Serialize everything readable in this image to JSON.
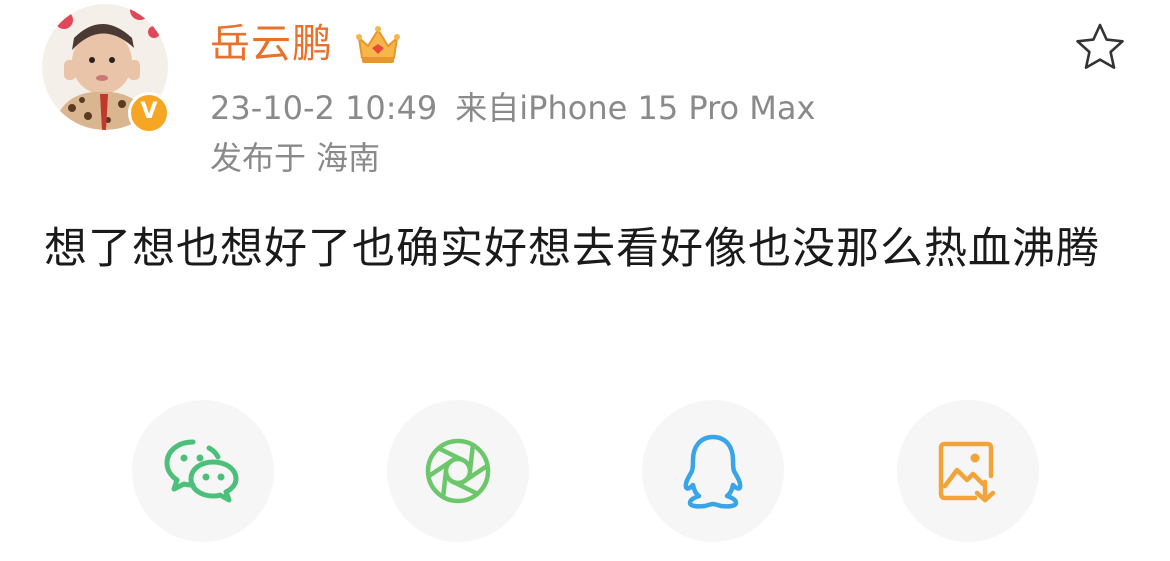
{
  "post": {
    "author": "岳云鹏",
    "timestamp": "23-10-2 10:49",
    "source": "来自iPhone 15 Pro Max",
    "location_prefix": "发布于",
    "location": "海南",
    "text": "想了想也想好了也确实好想去看好像也没那么热血沸腾",
    "verified_mark": "V"
  },
  "icons": {
    "vip": "crown-icon",
    "favorite": "star-icon",
    "share": [
      "wechat-icon",
      "moments-icon",
      "qq-icon",
      "save-image-icon"
    ]
  },
  "colors": {
    "author": "#e8712b",
    "meta": "#8a8a8a",
    "body_text": "#1a1a1a",
    "wechat": "#4cc07a",
    "moments": "#6cc66a",
    "qq": "#3aa4e8",
    "save_image": "#f2a33a",
    "verified": "#f6a623"
  }
}
